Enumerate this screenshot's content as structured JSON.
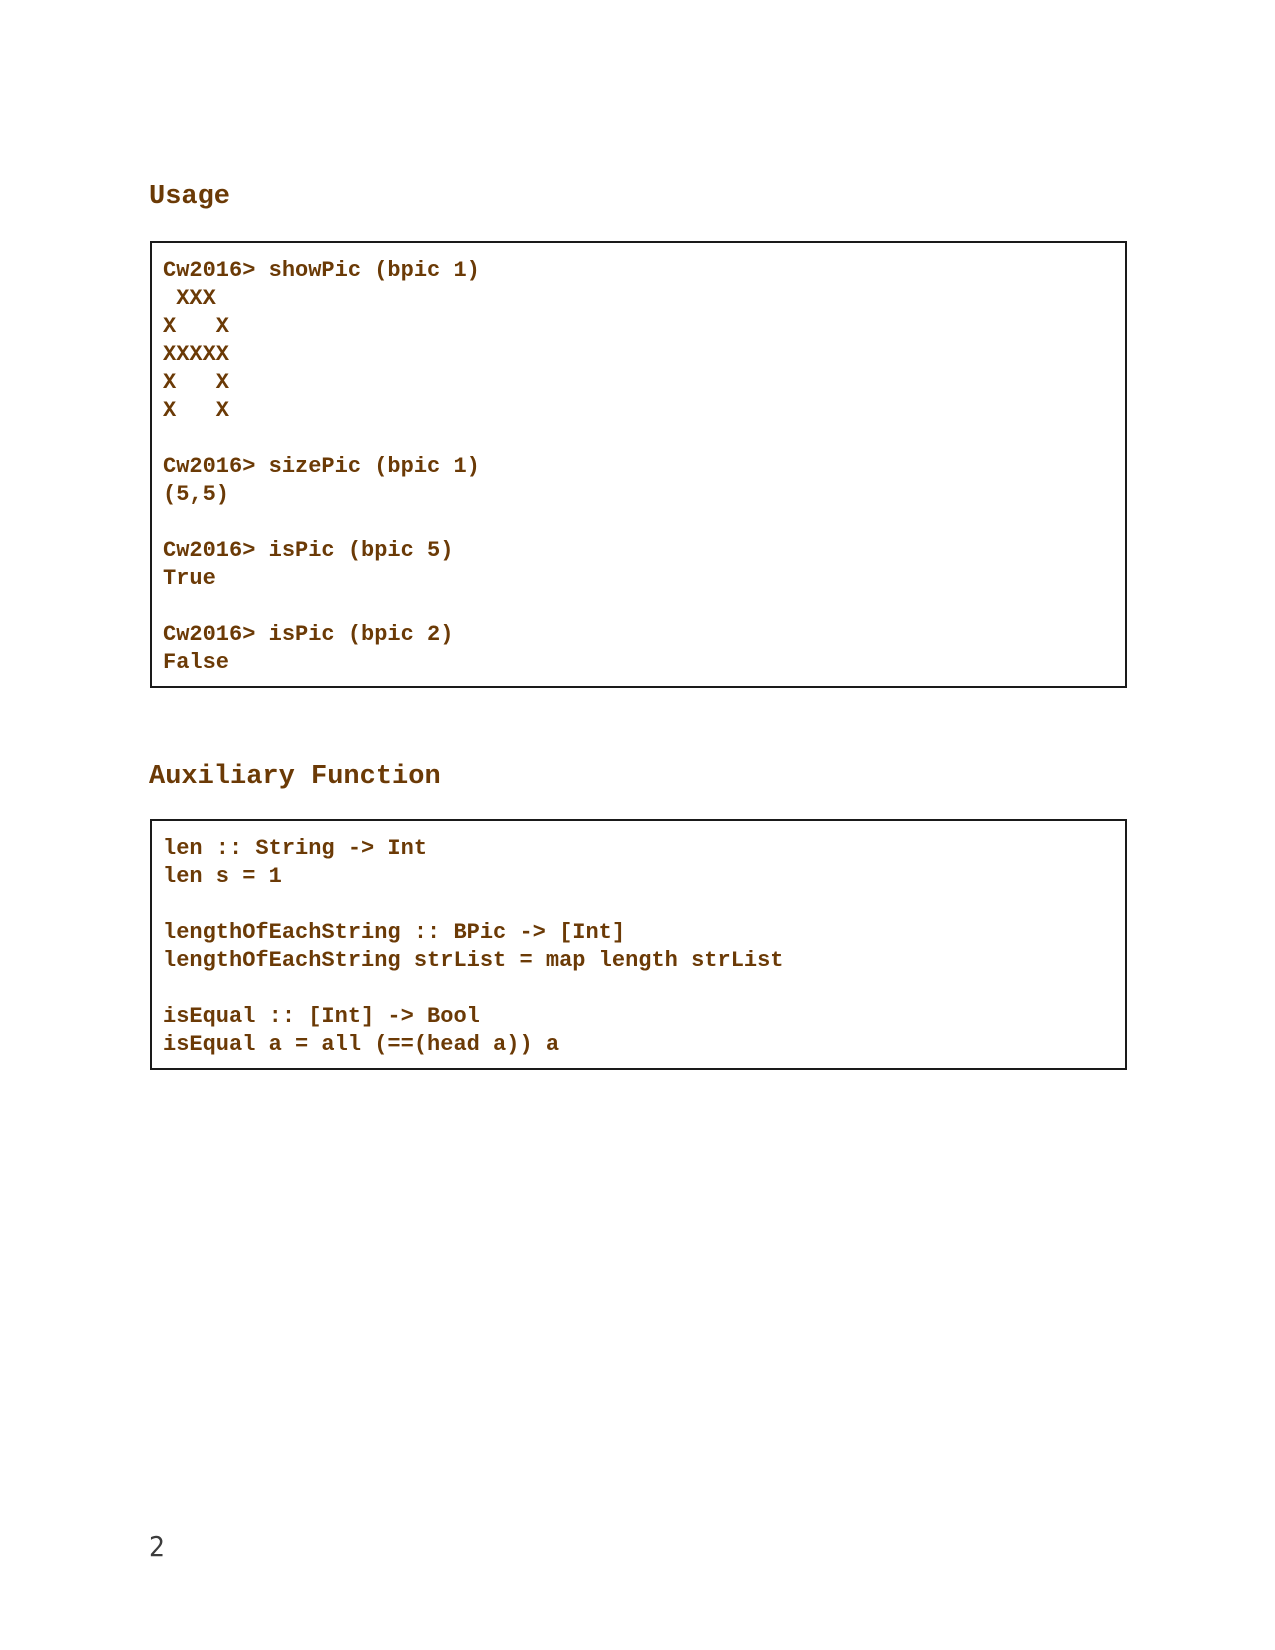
{
  "usage": {
    "heading": "Usage",
    "lines": [
      "Cw2016> showPic (bpic 1)",
      " XXX",
      "X   X",
      "XXXXX",
      "X   X",
      "X   X",
      "",
      "Cw2016> sizePic (bpic 1)",
      "(5,5)",
      "",
      "Cw2016> isPic (bpic 5)",
      "True",
      "",
      "Cw2016> isPic (bpic 2)",
      "False"
    ]
  },
  "auxiliary": {
    "heading": "Auxiliary Function",
    "lines": [
      "len :: String -> Int",
      "len s = 1",
      "",
      "lengthOfEachString :: BPic -> [Int]",
      "lengthOfEachString strList = map length strList",
      "",
      "isEqual :: [Int] -> Bool",
      "isEqual a = all (==(head a)) a"
    ]
  },
  "page_number": "2"
}
